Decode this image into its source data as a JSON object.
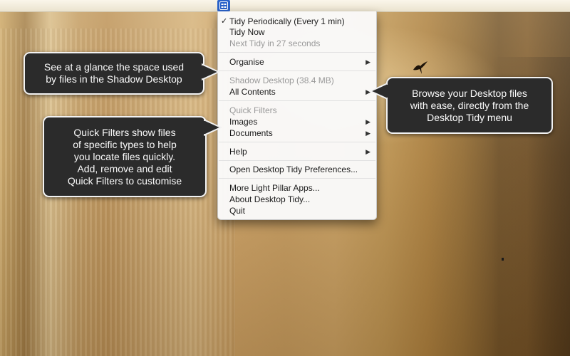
{
  "menu": {
    "items": [
      {
        "label": "Tidy Periodically (Every 1 min)",
        "checked": true,
        "disabled": false,
        "submenu": false
      },
      {
        "label": "Tidy Now",
        "checked": false,
        "disabled": false,
        "submenu": false
      },
      {
        "label": "Next Tidy in 27 seconds",
        "checked": false,
        "disabled": true,
        "submenu": false
      },
      {
        "label": "Organise",
        "checked": false,
        "disabled": false,
        "submenu": true
      },
      {
        "label": "Shadow Desktop (38.4 MB)",
        "checked": false,
        "disabled": true,
        "submenu": false
      },
      {
        "label": "All Contents",
        "checked": false,
        "disabled": false,
        "submenu": true
      },
      {
        "label": "Quick Filters",
        "checked": false,
        "disabled": true,
        "submenu": false
      },
      {
        "label": "Images",
        "checked": false,
        "disabled": false,
        "submenu": true
      },
      {
        "label": "Documents",
        "checked": false,
        "disabled": false,
        "submenu": true
      },
      {
        "label": "Help",
        "checked": false,
        "disabled": false,
        "submenu": true
      },
      {
        "label": "Open Desktop Tidy Preferences...",
        "checked": false,
        "disabled": false,
        "submenu": false
      },
      {
        "label": "More Light Pillar Apps...",
        "checked": false,
        "disabled": false,
        "submenu": false
      },
      {
        "label": "About Desktop Tidy...",
        "checked": false,
        "disabled": false,
        "submenu": false
      },
      {
        "label": "Quit",
        "checked": false,
        "disabled": false,
        "submenu": false
      }
    ],
    "checkmark": "✓",
    "submenu_arrow": "▶"
  },
  "callouts": {
    "shadow": {
      "lines": [
        "See at a glance the space used",
        "by files in the Shadow Desktop"
      ]
    },
    "filters": {
      "lines": [
        "Quick Filters show files",
        "of specific types to help",
        "you locate files quickly.",
        "Add, remove and edit",
        "Quick Filters to customise"
      ]
    },
    "browse": {
      "lines": [
        "Browse your Desktop files",
        "with ease, directly from the",
        "Desktop Tidy menu"
      ]
    }
  },
  "colors": {
    "callout_bg": "#2b2b2b",
    "callout_border": "#f2f2f2",
    "menu_bg": "#fafafa",
    "status_item": "#2a62c9"
  },
  "icons": {
    "status_item": "desktop-tidy-icon"
  }
}
